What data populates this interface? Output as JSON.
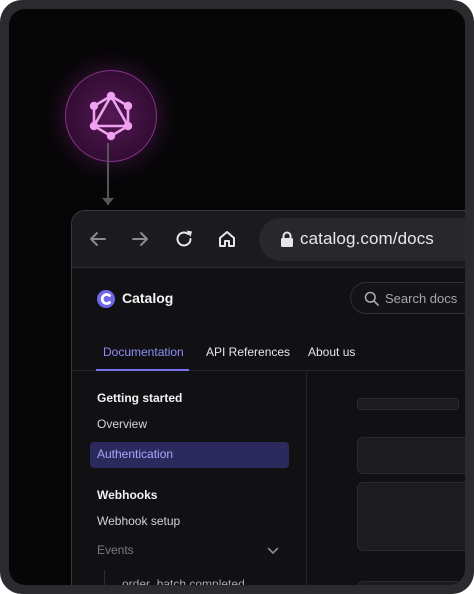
{
  "graph_icon": "graphql-icon",
  "browser": {
    "toolbar_icons": [
      "back-arrow-icon",
      "forward-arrow-icon",
      "reload-icon",
      "home-icon",
      "lock-icon"
    ],
    "url": "catalog.com/docs"
  },
  "site": {
    "logo_text": "Catalog",
    "search_placeholder": "Search docs",
    "tabs": [
      {
        "label": "Documentation",
        "active": true
      },
      {
        "label": "API References",
        "active": false
      },
      {
        "label": "About us",
        "active": false
      }
    ],
    "sidebar": {
      "heading_getting_started": "Getting started",
      "item_overview": "Overview",
      "item_authentication": "Authentication",
      "heading_webhooks": "Webhooks",
      "item_webhook_setup": "Webhook setup",
      "item_events": "Events",
      "sub_item_order_batch": "order_batch.completed"
    }
  },
  "colors": {
    "accent": "#7a6ff0",
    "accent_text": "#8f8cf7",
    "graphql_pink": "#e879e8",
    "background": "#060607"
  }
}
